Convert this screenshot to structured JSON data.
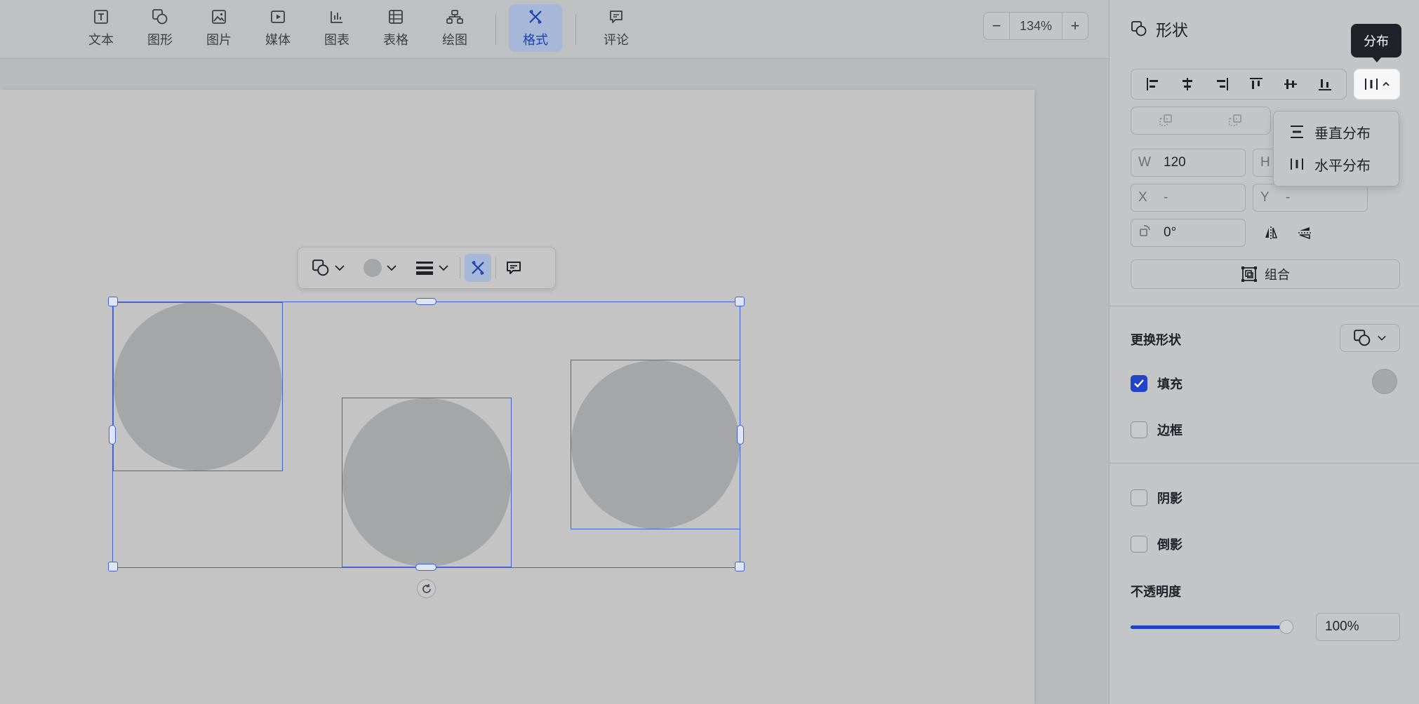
{
  "toolbar": {
    "items": [
      {
        "label": "文本",
        "icon": "text-icon"
      },
      {
        "label": "图形",
        "icon": "shape-icon"
      },
      {
        "label": "图片",
        "icon": "image-icon"
      },
      {
        "label": "媒体",
        "icon": "media-icon"
      },
      {
        "label": "图表",
        "icon": "chart-icon"
      },
      {
        "label": "表格",
        "icon": "table-icon"
      },
      {
        "label": "绘图",
        "icon": "diagram-icon"
      },
      {
        "label": "格式",
        "icon": "format-icon",
        "active": true
      },
      {
        "label": "评论",
        "icon": "comment-icon"
      }
    ],
    "zoom": {
      "minus": "−",
      "value": "134%",
      "plus": "+"
    }
  },
  "colors": {
    "accent": "#2343c9",
    "selection": "#3f63d6",
    "shape_fill": "#a5a6a8"
  },
  "panel": {
    "title": "形状",
    "tooltip": "分布",
    "distribute_menu": {
      "vertical": "垂直分布",
      "horizontal": "水平分布"
    },
    "size": {
      "w_label": "W",
      "w_value": "120",
      "h_label": "H"
    },
    "position": {
      "x_label": "X",
      "x_value": "-",
      "y_label": "Y",
      "y_value": "-"
    },
    "rotation": "0°",
    "group_button": "组合",
    "change_shape": "更换形状",
    "fill": {
      "label": "填充",
      "checked": true
    },
    "border": {
      "label": "边框",
      "checked": false
    },
    "shadow": {
      "label": "阴影",
      "checked": false
    },
    "reflection": {
      "label": "倒影",
      "checked": false
    },
    "opacity": {
      "label": "不透明度",
      "value": "100%",
      "level": 1.0
    }
  }
}
